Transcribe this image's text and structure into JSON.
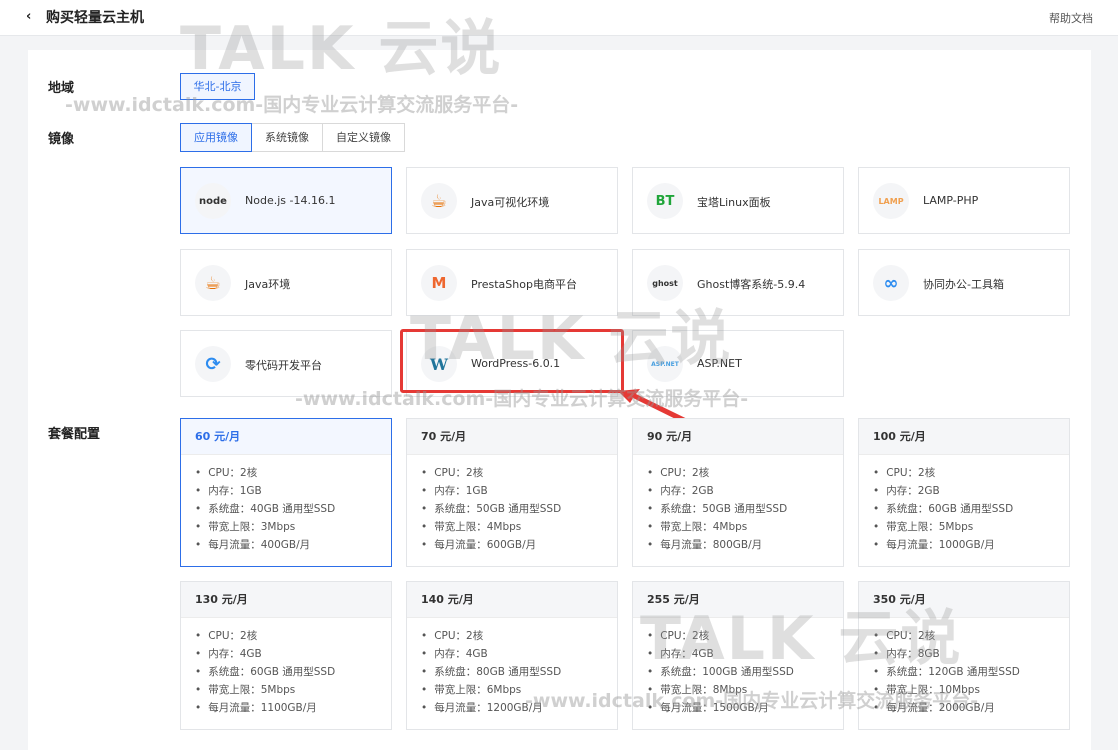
{
  "header": {
    "back_icon": "‹",
    "title": "购买轻量云主机",
    "help": "帮助文档"
  },
  "region": {
    "label": "地域",
    "selected": "华北-北京"
  },
  "image": {
    "label": "镜像",
    "tabs": [
      "应用镜像",
      "系统镜像",
      "自定义镜像"
    ],
    "items": [
      {
        "name": "Node.js -14.16.1",
        "icon": "node"
      },
      {
        "name": "Java可视化环境",
        "icon": "☕"
      },
      {
        "name": "宝塔Linux面板",
        "icon": "BT"
      },
      {
        "name": "LAMP-PHP",
        "icon": "LAMP"
      },
      {
        "name": "Java环境",
        "icon": "☕"
      },
      {
        "name": "PrestaShop电商平台",
        "icon": "M"
      },
      {
        "name": "Ghost博客系统-5.9.4",
        "icon": "ghost"
      },
      {
        "name": "协同办公-工具箱",
        "icon": "∞"
      },
      {
        "name": "零代码开发平台",
        "icon": "⟳"
      },
      {
        "name": "WordPress-6.0.1",
        "icon": "W"
      },
      {
        "name": "ASP.NET",
        "icon": "ASP.NET"
      }
    ]
  },
  "plans": {
    "label": "套餐配置",
    "items": [
      {
        "price": "60 元/月",
        "specs": [
          "CPU：2核",
          "内存：1GB",
          "系统盘：40GB 通用型SSD",
          "带宽上限：3Mbps",
          "每月流量：400GB/月"
        ]
      },
      {
        "price": "70 元/月",
        "specs": [
          "CPU：2核",
          "内存：1GB",
          "系统盘：50GB 通用型SSD",
          "带宽上限：4Mbps",
          "每月流量：600GB/月"
        ]
      },
      {
        "price": "90 元/月",
        "specs": [
          "CPU：2核",
          "内存：2GB",
          "系统盘：50GB 通用型SSD",
          "带宽上限：4Mbps",
          "每月流量：800GB/月"
        ]
      },
      {
        "price": "100 元/月",
        "specs": [
          "CPU：2核",
          "内存：2GB",
          "系统盘：60GB 通用型SSD",
          "带宽上限：5Mbps",
          "每月流量：1000GB/月"
        ]
      },
      {
        "price": "130 元/月",
        "specs": [
          "CPU：2核",
          "内存：4GB",
          "系统盘：60GB 通用型SSD",
          "带宽上限：5Mbps",
          "每月流量：1100GB/月"
        ]
      },
      {
        "price": "140 元/月",
        "specs": [
          "CPU：2核",
          "内存：4GB",
          "系统盘：80GB 通用型SSD",
          "带宽上限：6Mbps",
          "每月流量：1200GB/月"
        ]
      },
      {
        "price": "255 元/月",
        "specs": [
          "CPU：2核",
          "内存：4GB",
          "系统盘：100GB 通用型SSD",
          "带宽上限：8Mbps",
          "每月流量：1500GB/月"
        ]
      },
      {
        "price": "350 元/月",
        "specs": [
          "CPU：2核",
          "内存：8GB",
          "系统盘：120GB 通用型SSD",
          "带宽上限：10Mbps",
          "每月流量：2000GB/月"
        ]
      }
    ]
  },
  "watermark": {
    "brand": "TALK 云说",
    "url": "-www.idctalk.com-国内专业云计算交流服务平台-"
  },
  "colors": {
    "accent": "#2d6ee8",
    "highlight": "#e53935"
  }
}
